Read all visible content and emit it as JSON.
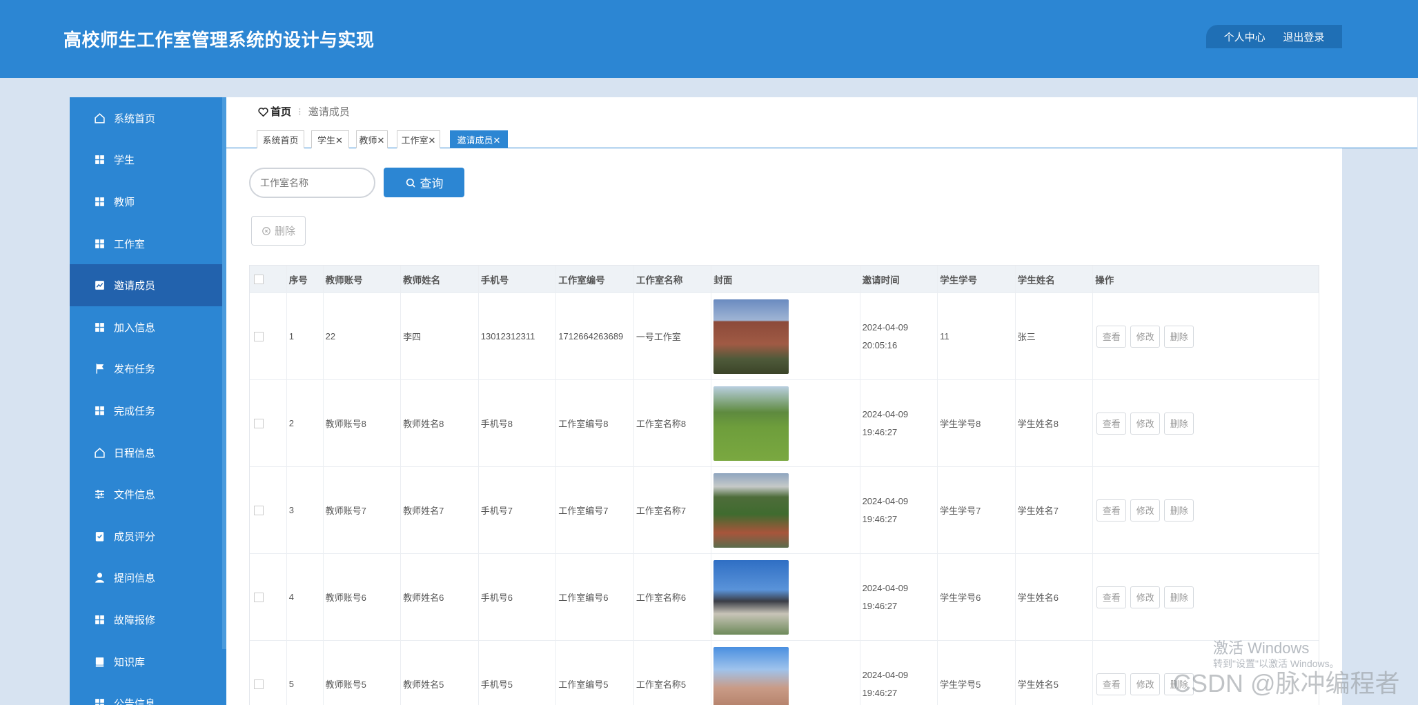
{
  "app": {
    "title": "高校师生工作室管理系统的设计与实现"
  },
  "header_menu": {
    "profile": "个人中心",
    "logout": "退出登录"
  },
  "sidebar": {
    "items": [
      {
        "label": "系统首页",
        "icon": "home-icon"
      },
      {
        "label": "学生",
        "icon": "grid-icon"
      },
      {
        "label": "教师",
        "icon": "grid-icon"
      },
      {
        "label": "工作室",
        "icon": "grid-icon"
      },
      {
        "label": "邀请成员",
        "icon": "chart-icon"
      },
      {
        "label": "加入信息",
        "icon": "grid-icon"
      },
      {
        "label": "发布任务",
        "icon": "flag-icon"
      },
      {
        "label": "完成任务",
        "icon": "grid-icon"
      },
      {
        "label": "日程信息",
        "icon": "home-icon"
      },
      {
        "label": "文件信息",
        "icon": "sliders-icon"
      },
      {
        "label": "成员评分",
        "icon": "clipboard-icon"
      },
      {
        "label": "提问信息",
        "icon": "user-icon"
      },
      {
        "label": "故障报修",
        "icon": "grid-icon"
      },
      {
        "label": "知识库",
        "icon": "book-icon"
      },
      {
        "label": "公告信息",
        "icon": "grid-icon"
      }
    ]
  },
  "breadcrumb": {
    "home": "首页",
    "current": "邀请成员"
  },
  "tabs": [
    {
      "label": "系统首页"
    },
    {
      "label": "学生✕"
    },
    {
      "label": "教师✕"
    },
    {
      "label": "工作室✕"
    },
    {
      "label": "邀请成员✕"
    }
  ],
  "search": {
    "placeholder": "工作室名称",
    "button": "查询"
  },
  "toolbar": {
    "delete": "删除"
  },
  "table": {
    "headers": [
      "序号",
      "教师账号",
      "教师姓名",
      "手机号",
      "工作室编号",
      "工作室名称",
      "封面",
      "邀请时间",
      "学生学号",
      "学生姓名",
      "操作"
    ],
    "rows": [
      {
        "no": "1",
        "teacher_account": "22",
        "teacher_name": "李四",
        "phone": "13012312311",
        "studio_no": "1712664263689",
        "studio_name": "一号工作室",
        "time": "2024-04-09 20:05:16",
        "student_no": "11",
        "student_name": "张三"
      },
      {
        "no": "2",
        "teacher_account": "教师账号8",
        "teacher_name": "教师姓名8",
        "phone": "手机号8",
        "studio_no": "工作室编号8",
        "studio_name": "工作室名称8",
        "time": "2024-04-09 19:46:27",
        "student_no": "学生学号8",
        "student_name": "学生姓名8"
      },
      {
        "no": "3",
        "teacher_account": "教师账号7",
        "teacher_name": "教师姓名7",
        "phone": "手机号7",
        "studio_no": "工作室编号7",
        "studio_name": "工作室名称7",
        "time": "2024-04-09 19:46:27",
        "student_no": "学生学号7",
        "student_name": "学生姓名7"
      },
      {
        "no": "4",
        "teacher_account": "教师账号6",
        "teacher_name": "教师姓名6",
        "phone": "手机号6",
        "studio_no": "工作室编号6",
        "studio_name": "工作室名称6",
        "time": "2024-04-09 19:46:27",
        "student_no": "学生学号6",
        "student_name": "学生姓名6"
      },
      {
        "no": "5",
        "teacher_account": "教师账号5",
        "teacher_name": "教师姓名5",
        "phone": "手机号5",
        "studio_no": "工作室编号5",
        "studio_name": "工作室名称5",
        "time": "2024-04-09 19:46:27",
        "student_no": "学生学号5",
        "student_name": "学生姓名5"
      }
    ],
    "actions": {
      "view": "查看",
      "edit": "修改",
      "delete": "删除"
    }
  },
  "watermark": {
    "line1": "激活 Windows",
    "line2": "转到\"设置\"以激活 Windows。",
    "csdn": "CSDN @脉冲编程者"
  },
  "colors": {
    "primary": "#2c86d3",
    "active": "#2262ad",
    "background": "#d7e3f1"
  }
}
